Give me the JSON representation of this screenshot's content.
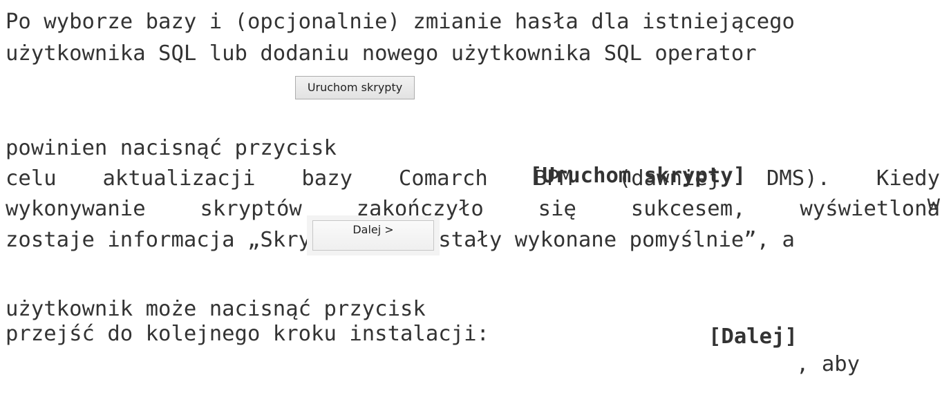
{
  "paragraph": {
    "line1": "Po wyborze bazy i (opcjonalnie) zmianie hasła dla istniejącego",
    "line2": "użytkownika SQL lub dodaniu nowego użytkownika SQL operator",
    "line3_before": "powinien nacisnąć przycisk",
    "line3_bold": "[Uruchom skrypty]",
    "line3_after": "w",
    "line4": "celu aktualizacji bazy Comarch BPM (dawniej DMS). Kiedy",
    "line5": "wykonywanie skryptów zakończyło się sukcesem, wyświetlona",
    "line6": "zostaje informacja „Skrypty SQL zostały wykonane pomyślnie”, a",
    "line7_before": "użytkownik może nacisnąć przycisk",
    "line7_bold": "[Dalej]",
    "line7_after": ", aby",
    "line8": "przejść do kolejnego kroku instalacji:"
  },
  "buttons": {
    "run_scripts_label": "Uruchom skrypty",
    "next_label": "Dalej >"
  }
}
